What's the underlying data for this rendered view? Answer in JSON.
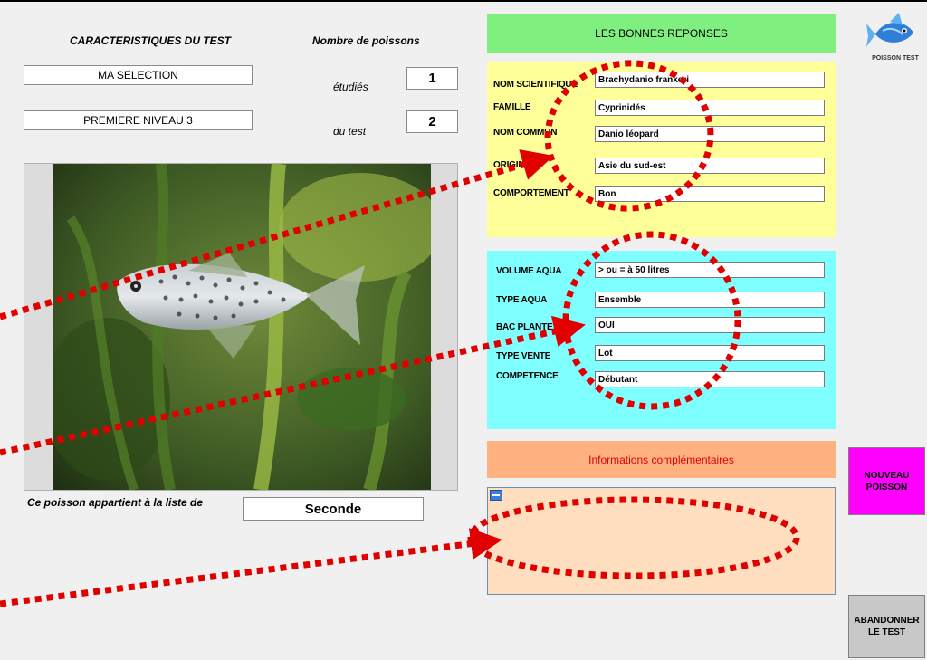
{
  "left": {
    "characteristics_title": "CARACTERISTIQUES DU TEST",
    "nb_poissons_title": "Nombre  de  poissons",
    "selection_value": "MA SELECTION",
    "level_value": "PREMIERE NIVEAU 3",
    "etudies_label": "étudiés",
    "etudies_value": "1",
    "dutest_label": "du test",
    "dutest_value": "2",
    "list_label": "Ce poisson appartient  à la liste de",
    "list_value": "Seconde"
  },
  "answers": {
    "header": "LES BONNES REPONSES",
    "id_fields": [
      {
        "label": "NOM SCIENTIFIQUE",
        "value": "Brachydanio frankeri"
      },
      {
        "label": "FAMILLE",
        "value": "Cyprinidés"
      },
      {
        "label": "NOM COMMUN",
        "value": "Danio léopard"
      },
      {
        "label": "ORIGINE",
        "value": "Asie du sud-est"
      },
      {
        "label": "COMPORTEMENT",
        "value": "Bon"
      }
    ],
    "care_fields": [
      {
        "label": "VOLUME AQUA",
        "value": "> ou = à 50 litres"
      },
      {
        "label": "TYPE AQUA",
        "value": "Ensemble"
      },
      {
        "label": "BAC PLANTE",
        "value": "OUI"
      },
      {
        "label": "TYPE VENTE",
        "value": "Lot"
      },
      {
        "label": "COMPETENCE",
        "value": "Débutant"
      }
    ]
  },
  "info": {
    "header": "Informations complémentaires",
    "text": ""
  },
  "side": {
    "logo_text": "POISSON TEST",
    "new_fish_label": "NOUVEAU POISSON",
    "quit_label": "ABANDONNER LE TEST"
  },
  "colors": {
    "green_header": "#7ff07f",
    "yellow_panel": "#ffff99",
    "cyan_panel": "#7fffff",
    "orange_header": "#ffb27f",
    "peach_panel": "#ffdfbf",
    "magenta_button": "#ff00ff",
    "annotation_red": "#e00000"
  }
}
